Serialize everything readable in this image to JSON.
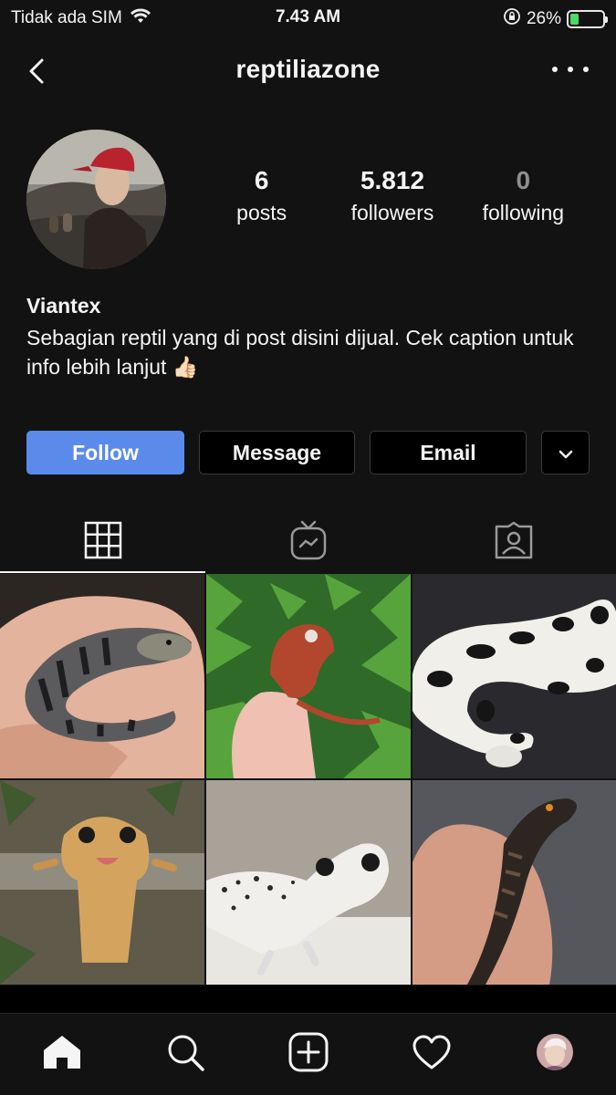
{
  "status_bar": {
    "carrier": "Tidak ada SIM",
    "time": "7.43 AM",
    "battery": "26%",
    "battery_level": 0.26,
    "battery_color": "#4cd964"
  },
  "header": {
    "username": "reptiliazone",
    "back_icon": "chevron-left-icon",
    "more_icon": "more-horizontal-icon"
  },
  "profile": {
    "stats": [
      {
        "value": "6",
        "label": "posts"
      },
      {
        "value": "5.812",
        "label": "followers"
      },
      {
        "value": "0",
        "label": "following"
      }
    ],
    "name": "Viantex",
    "bio": "Sebagian reptil yang di post disini dijual. Cek caption untuk info lebih lanjut 👍🏻"
  },
  "actions": {
    "follow": "Follow",
    "message": "Message",
    "email": "Email",
    "dropdown_icon": "chevron-down-icon",
    "accent": "#5a8bea"
  },
  "tabs": [
    {
      "icon": "grid-icon",
      "active": true
    },
    {
      "icon": "igtv-icon",
      "active": false
    },
    {
      "icon": "tagged-user-icon",
      "active": false
    }
  ],
  "posts": [
    {
      "subject": "blue-tongue-skink"
    },
    {
      "subject": "gargoyle-gecko"
    },
    {
      "subject": "ball-python"
    },
    {
      "subject": "crested-gecko"
    },
    {
      "subject": "leopard-gecko"
    },
    {
      "subject": "crocodile-skink"
    }
  ],
  "bottom_nav": [
    "home-icon",
    "search-icon",
    "new-post-icon",
    "heart-icon",
    "profile-avatar"
  ]
}
